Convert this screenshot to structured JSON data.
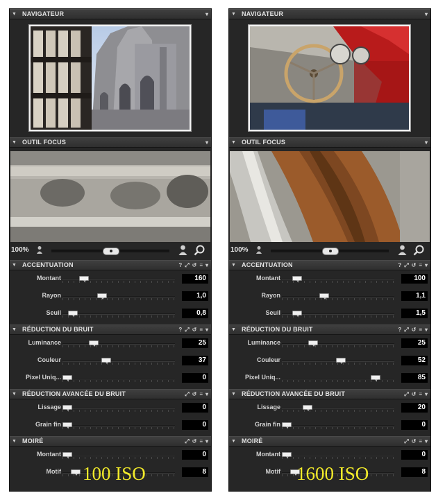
{
  "panels": [
    {
      "navigator_title": "NAVIGATEUR",
      "focus_title": "OUTIL FOCUS",
      "zoom": "100%",
      "zoom_slider": 0.5,
      "iso_label": "100 ISO",
      "sections": [
        {
          "title": "ACCENTUATION",
          "icons": [
            "help-icon",
            "expand-icon",
            "reset-icon",
            "menu-icon",
            "chevron-down-icon"
          ],
          "rows": [
            {
              "label": "Montant",
              "value": "160",
              "slider": 0.16
            },
            {
              "label": "Rayon",
              "value": "1,0",
              "slider": 0.33
            },
            {
              "label": "Seuil",
              "value": "0,8",
              "slider": 0.05
            }
          ]
        },
        {
          "title": "RÉDUCTION DU BRUIT",
          "icons": [
            "help-icon",
            "expand-icon",
            "reset-icon",
            "menu-icon",
            "chevron-down-icon"
          ],
          "rows": [
            {
              "label": "Luminance",
              "value": "25",
              "slider": 0.25
            },
            {
              "label": "Couleur",
              "value": "37",
              "slider": 0.37
            },
            {
              "label": "Pixel Uniq...",
              "value": "0",
              "slider": 0.0
            }
          ]
        },
        {
          "title": "RÉDUCTION AVANCÉE DU BRUIT",
          "icons": [
            "expand-icon",
            "reset-icon",
            "menu-icon",
            "chevron-down-icon"
          ],
          "rows": [
            {
              "label": "Lissage",
              "value": "0",
              "slider": 0.0
            },
            {
              "label": "Grain fin",
              "value": "0",
              "slider": 0.0
            }
          ]
        },
        {
          "title": "MOIRÉ",
          "icons": [
            "expand-icon",
            "reset-icon",
            "menu-icon",
            "chevron-down-icon"
          ],
          "rows": [
            {
              "label": "Montant",
              "value": "0",
              "slider": 0.0
            },
            {
              "label": "Motif",
              "value": "8",
              "slider": 0.08
            }
          ]
        }
      ]
    },
    {
      "navigator_title": "NAVIGATEUR",
      "focus_title": "OUTIL FOCUS",
      "zoom": "100%",
      "zoom_slider": 0.5,
      "iso_label": "1600 ISO",
      "sections": [
        {
          "title": "ACCENTUATION",
          "icons": [
            "help-icon",
            "expand-icon",
            "reset-icon",
            "menu-icon",
            "chevron-down-icon"
          ],
          "rows": [
            {
              "label": "Montant",
              "value": "100",
              "slider": 0.1
            },
            {
              "label": "Rayon",
              "value": "1,1",
              "slider": 0.36
            },
            {
              "label": "Seuil",
              "value": "1,5",
              "slider": 0.1
            }
          ]
        },
        {
          "title": "RÉDUCTION DU BRUIT",
          "icons": [
            "help-icon",
            "expand-icon",
            "reset-icon",
            "menu-icon",
            "chevron-down-icon"
          ],
          "rows": [
            {
              "label": "Luminance",
              "value": "25",
              "slider": 0.25
            },
            {
              "label": "Couleur",
              "value": "52",
              "slider": 0.52
            },
            {
              "label": "Pixel Uniq...",
              "value": "85",
              "slider": 0.85
            }
          ]
        },
        {
          "title": "RÉDUCTION AVANCÉE DU BRUIT",
          "icons": [
            "expand-icon",
            "reset-icon",
            "menu-icon",
            "chevron-down-icon"
          ],
          "rows": [
            {
              "label": "Lissage",
              "value": "20",
              "slider": 0.2
            },
            {
              "label": "Grain fin",
              "value": "0",
              "slider": 0.0
            }
          ]
        },
        {
          "title": "MOIRÉ",
          "icons": [
            "expand-icon",
            "reset-icon",
            "menu-icon",
            "chevron-down-icon"
          ],
          "rows": [
            {
              "label": "Montant",
              "value": "0",
              "slider": 0.0
            },
            {
              "label": "Motif",
              "value": "8",
              "slider": 0.08
            }
          ]
        }
      ]
    }
  ]
}
